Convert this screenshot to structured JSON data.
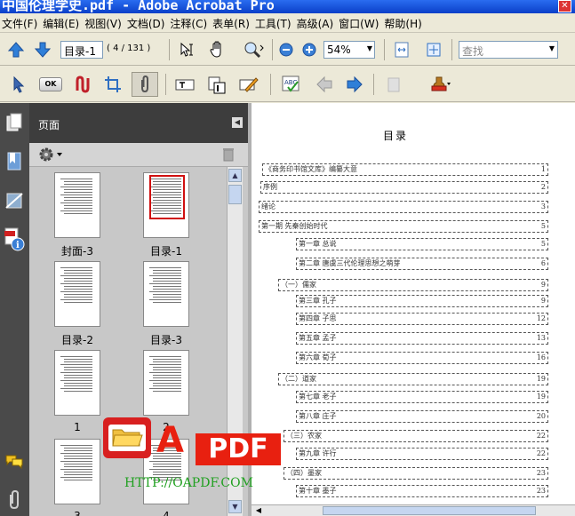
{
  "window": {
    "title": "中国伦理学史.pdf - Adobe Acrobat Pro"
  },
  "menu": [
    "文件(F)",
    "编辑(E)",
    "视图(V)",
    "文档(D)",
    "注释(C)",
    "表单(R)",
    "工具(T)",
    "高级(A)",
    "窗口(W)",
    "帮助(H)"
  ],
  "toolbar": {
    "page_label": "目录-1",
    "page_counter": "( 4 / 131 )",
    "zoom": "54%",
    "search_placeholder": "查找",
    "ok_label": "OK"
  },
  "panel": {
    "title": "页面"
  },
  "thumbnails": [
    {
      "label": "封面-3"
    },
    {
      "label": "目录-1",
      "selected": true
    },
    {
      "label": "目录-2"
    },
    {
      "label": "目录-3"
    },
    {
      "label": "1"
    },
    {
      "label": "2"
    },
    {
      "label": "3"
    },
    {
      "label": "4"
    }
  ],
  "document": {
    "heading": "目录",
    "entries": [
      {
        "text": "《商务印书馆文库》编纂大意",
        "page": "1"
      },
      {
        "text": "序例",
        "page": "2"
      },
      {
        "text": "绪论",
        "page": "3"
      },
      {
        "text": "第一期 先秦创始时代",
        "page": "5"
      },
      {
        "text": "第一章 总说",
        "page": "5"
      },
      {
        "text": "第二章 唐虞三代伦理思想之萌芽",
        "page": "6"
      },
      {
        "text": "（一）儒家",
        "page": "9"
      },
      {
        "text": "第三章 孔子",
        "page": "9"
      },
      {
        "text": "第四章 子思",
        "page": "12"
      },
      {
        "text": "第五章 孟子",
        "page": "13"
      },
      {
        "text": "第六章 荀子",
        "page": "16"
      },
      {
        "text": "（二）道家",
        "page": "19"
      },
      {
        "text": "第七章 老子",
        "page": "19"
      },
      {
        "text": "第八章 庄子",
        "page": "20"
      },
      {
        "text": "（三）农家",
        "page": "22"
      },
      {
        "text": "第九章 许行",
        "page": "22"
      },
      {
        "text": "（四）墨家",
        "page": "23"
      },
      {
        "text": "第十章 墨子",
        "page": "23"
      }
    ]
  },
  "watermark": {
    "brand_letter": "A",
    "brand_text": "PDF",
    "url": "HTTP://OAPDF.COM"
  }
}
